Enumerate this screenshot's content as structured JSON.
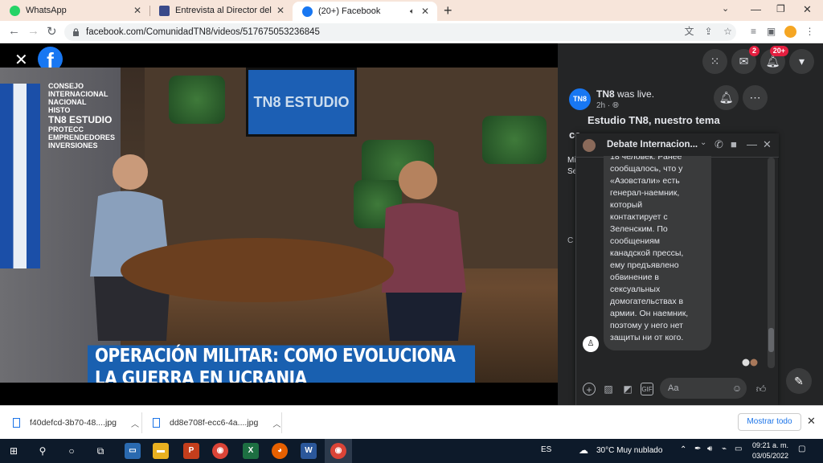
{
  "browser": {
    "tabs": [
      {
        "title": "WhatsApp",
        "favicon": "whatsapp-icon",
        "color": "#25d366"
      },
      {
        "title": "Entrevista al Director del CREI, en",
        "favicon": "crei-icon",
        "color": "#3a4a8a"
      },
      {
        "title": "(20+) Facebook",
        "favicon": "facebook-icon",
        "color": "#1877f2"
      }
    ],
    "url": "facebook.com/ComunidadTN8/videos/517675053236845"
  },
  "video": {
    "close_label": "✕",
    "fb_logo": "f",
    "logo_lines": [
      "CONSEJO",
      "INTERNACIONAL",
      "NACIONAL",
      "HISTO",
      "TN8 ESTUDIO",
      "PROTECC",
      "EMPRENDEDORES",
      "INVERSIONES"
    ],
    "monitor_text": "TN8 ESTUDIO",
    "banner_text": "OPERACIÓN MILITAR: COMO EVOLUCIONA LA GUERRA EN UCRANIA"
  },
  "facebook": {
    "messenger_badge": "2",
    "notifications_badge": "20+",
    "post": {
      "page_name": "TN8",
      "status": "was live.",
      "time": "2h · ",
      "avatar_text": "TN8",
      "title_line1": "Estudio TN8, nuestro tema",
      "title_line2": "ce"
    },
    "side_fragments": [
      "Mi",
      "Se",
      "C"
    ],
    "chat": {
      "title": "Debate Internacion...",
      "message_lines": [
        "18 человек. Ранее",
        "сообщалось, что у",
        "«Азовстали» есть",
        "генерал-наемник,",
        "который",
        "контактирует с",
        "Зеленским. По",
        "сообщениям",
        "канадской прессы,",
        "ему предъявлено",
        "обвинение в",
        "сексуальных",
        "домогательствах в",
        "армии. Он наемник,",
        "поэтому у него нет",
        "защиты ни от кого."
      ],
      "composer_placeholder": "Aa"
    }
  },
  "downloads": {
    "items": [
      "f40defcd-3b70-48....jpg",
      "dd8e708f-ecc6-4a....jpg"
    ],
    "show_all": "Mostrar todo"
  },
  "taskbar": {
    "language": "ES",
    "weather": "30°C  Muy nublado",
    "time": "09:21 a. m.",
    "date": "03/05/2022"
  }
}
